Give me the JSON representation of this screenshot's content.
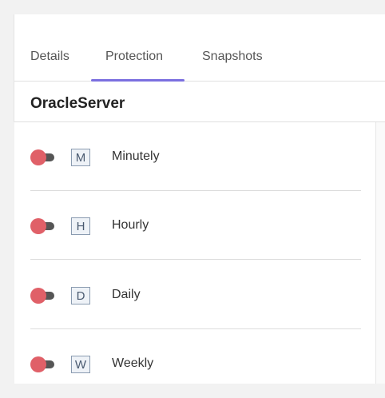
{
  "tabs": [
    {
      "label": "Details"
    },
    {
      "label": "Protection"
    },
    {
      "label": "Snapshots"
    }
  ],
  "active_tab": "Protection",
  "server": {
    "title": "OracleServer"
  },
  "schedules": [
    {
      "badge": "M",
      "label": "Minutely",
      "enabled": false
    },
    {
      "badge": "H",
      "label": "Hourly",
      "enabled": false
    },
    {
      "badge": "D",
      "label": "Daily",
      "enabled": false
    },
    {
      "badge": "W",
      "label": "Weekly",
      "enabled": false
    }
  ],
  "colors": {
    "accent": "#7b6fe0",
    "toggle_knob": "#e06068",
    "toggle_track": "#555555"
  }
}
